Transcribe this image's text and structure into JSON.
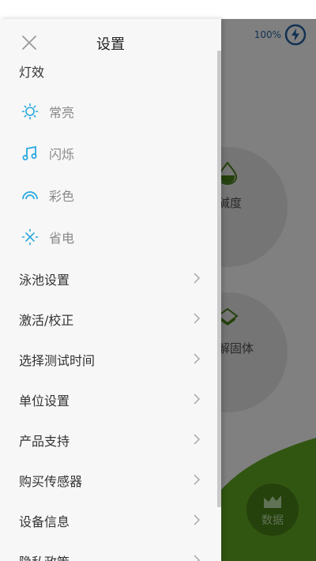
{
  "status_bar": {
    "battery_text": "100%"
  },
  "background": {
    "circle1_label": "碱度",
    "circle2_label": "解固体",
    "data_button_label": "数据"
  },
  "drawer": {
    "title": "设置",
    "section_title": "灯效",
    "light_items": [
      {
        "label": "常亮",
        "icon": "sun-icon"
      },
      {
        "label": "闪烁",
        "icon": "music-note-icon"
      },
      {
        "label": "彩色",
        "icon": "rainbow-icon"
      },
      {
        "label": "省电",
        "icon": "power-save-icon"
      }
    ],
    "menu_items": [
      {
        "label": "泳池设置"
      },
      {
        "label": "激活/校正"
      },
      {
        "label": "选择测试时间"
      },
      {
        "label": "单位设置"
      },
      {
        "label": "产品支持"
      },
      {
        "label": "购买传感器"
      },
      {
        "label": "设备信息"
      },
      {
        "label": "隐私政策"
      }
    ],
    "accent_color": "#29a8e0"
  }
}
